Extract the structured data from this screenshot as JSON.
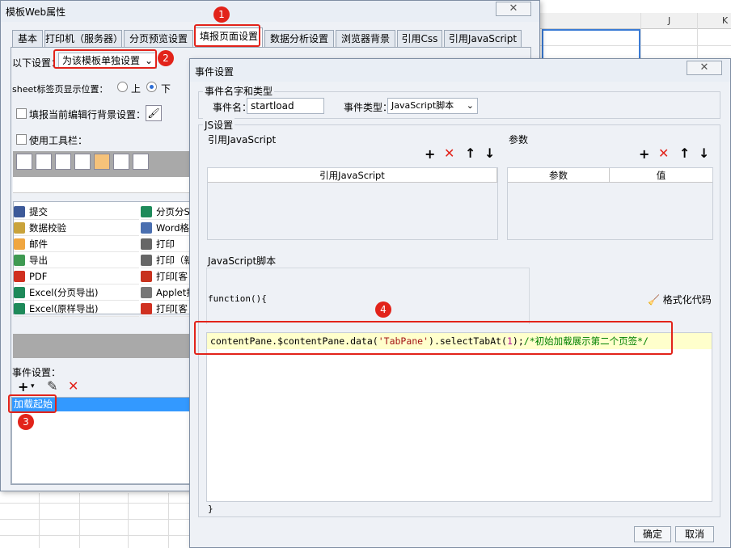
{
  "sheet": {
    "columns": [
      "J",
      "K"
    ]
  },
  "web_dialog": {
    "title": "模板Web属性",
    "close_glyph": "✕",
    "tabs": [
      "基本",
      "打印机（服务器）",
      "分页预览设置",
      "填报页面设置",
      "数据分析设置",
      "浏览器背景",
      "引用Css",
      "引用JavaScript"
    ],
    "active_tab": "填报页面设置",
    "settings_label": "以下设置：",
    "settings_value": "为该模板单独设置",
    "sheet_tab_pos_label": "sheet标签页显示位置：",
    "radio_top": "上",
    "radio_bottom": "下",
    "fill_bg_label": "填报当前编辑行背景设置：",
    "use_toolbar_label": "使用工具栏：",
    "buttons_left": [
      "提交",
      "数据校验",
      "邮件",
      "导出",
      "PDF",
      "Excel(分页导出)",
      "Excel(原样导出)"
    ],
    "buttons_right": [
      "分页分S",
      "Word格式",
      "打印",
      "打印（新",
      "打印[客",
      "Applet打",
      "打印[客"
    ],
    "event_settings_label": "事件设置：",
    "event_item": "加载起始"
  },
  "event_dialog": {
    "title": "事件设置",
    "close_glyph": "✕",
    "name_type_group": "事件名字和类型",
    "event_name_label": "事件名：",
    "event_name_value": "startload",
    "event_type_label": "事件类型：",
    "event_type_value": "JavaScript脚本",
    "js_group": "JS设置",
    "ref_js_label": "引用JavaScript",
    "params_label": "参数",
    "ref_js_col": "引用JavaScript",
    "param_col": "参数",
    "value_col": "值",
    "script_label": "JavaScript脚本",
    "func_open": "function(){",
    "format_code": "格式化代码",
    "code_prefix": "contentPane.$contentPane.data(",
    "code_string": "'TabPane'",
    "code_mid": ").selectTabAt(",
    "code_num": "1",
    "code_end": ");",
    "code_comment": "/*初始加载展示第二个页签*/",
    "func_close": "}",
    "ok_button": "确定",
    "cancel_button": "取消"
  },
  "callouts": [
    "1",
    "2",
    "3",
    "4"
  ],
  "colors": {
    "callout_red": "#e2231a",
    "selection_blue": "#3399ff",
    "code_string": "#a31515",
    "code_comment": "#008000",
    "code_number": "#b5169c",
    "code_line_bg": "#ffffcc"
  }
}
